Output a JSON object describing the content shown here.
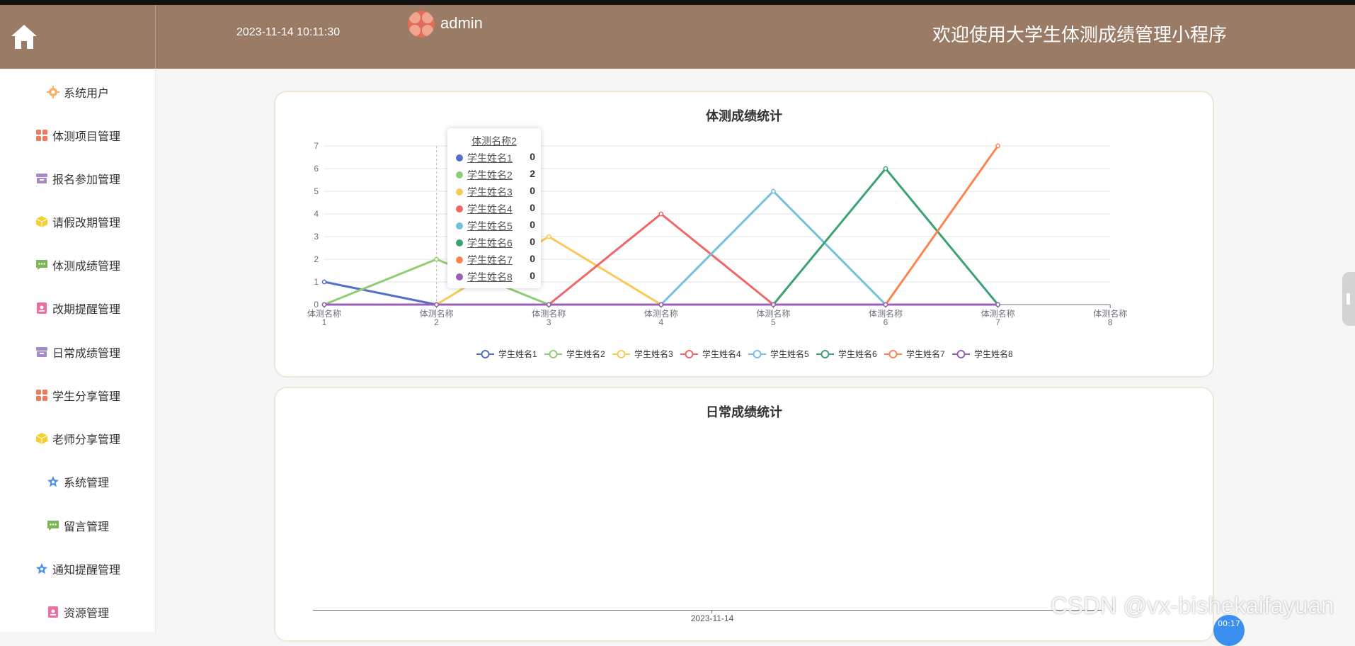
{
  "header": {
    "datetime": "2023-11-14 10:11:30",
    "username": "admin",
    "app_title": "欢迎使用大学生体测成绩管理小程序",
    "bg_color": "#9a7b66"
  },
  "sidebar": {
    "items": [
      {
        "label": "系统用户",
        "icon": "gear-icon",
        "color": "#f7b267"
      },
      {
        "label": "体测项目管理",
        "icon": "grid-icon",
        "color": "#ef7b5c"
      },
      {
        "label": "报名参加管理",
        "icon": "box-icon",
        "color": "#a889c8"
      },
      {
        "label": "请假改期管理",
        "icon": "cube-icon",
        "color": "#f4cf2d"
      },
      {
        "label": "体测成绩管理",
        "icon": "chat-icon",
        "color": "#7cb655"
      },
      {
        "label": "改期提醒管理",
        "icon": "doc-icon",
        "color": "#ea6fa3"
      },
      {
        "label": "日常成绩管理",
        "icon": "box-icon",
        "color": "#a889c8"
      },
      {
        "label": "学生分享管理",
        "icon": "grid-icon",
        "color": "#ef7b5c"
      },
      {
        "label": "老师分享管理",
        "icon": "cube-icon",
        "color": "#f4cf2d"
      },
      {
        "label": "系统管理",
        "icon": "star-icon",
        "color": "#4a8ff0"
      },
      {
        "label": "留言管理",
        "icon": "chat-icon",
        "color": "#7cb655"
      },
      {
        "label": "通知提醒管理",
        "icon": "star-icon",
        "color": "#4a8ff0"
      },
      {
        "label": "资源管理",
        "icon": "doc-icon",
        "color": "#ea6fa3"
      }
    ]
  },
  "chart1_title": "体测成绩统计",
  "chart2_title": "日常成绩统计",
  "chart2_xtick": "2023-11-14",
  "tooltip": {
    "title": "体测名称2",
    "rows": [
      {
        "name": "学生姓名1",
        "value": "0",
        "color": "#5470c6"
      },
      {
        "name": "学生姓名2",
        "value": "2",
        "color": "#91cc75"
      },
      {
        "name": "学生姓名3",
        "value": "0",
        "color": "#fac858"
      },
      {
        "name": "学生姓名4",
        "value": "0",
        "color": "#ee6666"
      },
      {
        "name": "学生姓名5",
        "value": "0",
        "color": "#73c0de"
      },
      {
        "name": "学生姓名6",
        "value": "0",
        "color": "#3ba272"
      },
      {
        "name": "学生姓名7",
        "value": "0",
        "color": "#fc8452"
      },
      {
        "name": "学生姓名8",
        "value": "0",
        "color": "#9a60b4"
      }
    ]
  },
  "watermark": "CSDN @vx-bishekaifayuan",
  "fab_label": "00:17",
  "chart_data": [
    {
      "type": "line",
      "title": "体测成绩统计",
      "categories": [
        "体测名称1",
        "体测名称2",
        "体测名称3",
        "体测名称4",
        "体测名称5",
        "体测名称6",
        "体测名称7",
        "体测名称8"
      ],
      "ylim": [
        0,
        7
      ],
      "yticks": [
        0,
        1,
        2,
        3,
        4,
        5,
        6,
        7
      ],
      "grid": true,
      "legend": "bottom",
      "series": [
        {
          "name": "学生姓名1",
          "color": "#5470c6",
          "values": [
            1,
            0,
            0,
            0,
            0,
            0,
            0,
            null
          ]
        },
        {
          "name": "学生姓名2",
          "color": "#91cc75",
          "values": [
            0,
            2,
            0,
            0,
            0,
            0,
            0,
            null
          ]
        },
        {
          "name": "学生姓名3",
          "color": "#fac858",
          "values": [
            0,
            0,
            3,
            0,
            0,
            0,
            0,
            null
          ]
        },
        {
          "name": "学生姓名4",
          "color": "#ee6666",
          "values": [
            0,
            0,
            0,
            4,
            0,
            0,
            0,
            null
          ]
        },
        {
          "name": "学生姓名5",
          "color": "#73c0de",
          "values": [
            0,
            0,
            0,
            0,
            5,
            0,
            0,
            null
          ]
        },
        {
          "name": "学生姓名6",
          "color": "#3ba272",
          "values": [
            0,
            0,
            0,
            0,
            0,
            6,
            0,
            null
          ]
        },
        {
          "name": "学生姓名7",
          "color": "#fc8452",
          "values": [
            0,
            0,
            0,
            0,
            0,
            0,
            7,
            null
          ]
        },
        {
          "name": "学生姓名8",
          "color": "#9a60b4",
          "values": [
            0,
            0,
            0,
            0,
            0,
            0,
            0,
            null
          ]
        }
      ]
    },
    {
      "type": "line",
      "title": "日常成绩统计",
      "categories": [
        "2023-11-14"
      ],
      "series": []
    }
  ]
}
